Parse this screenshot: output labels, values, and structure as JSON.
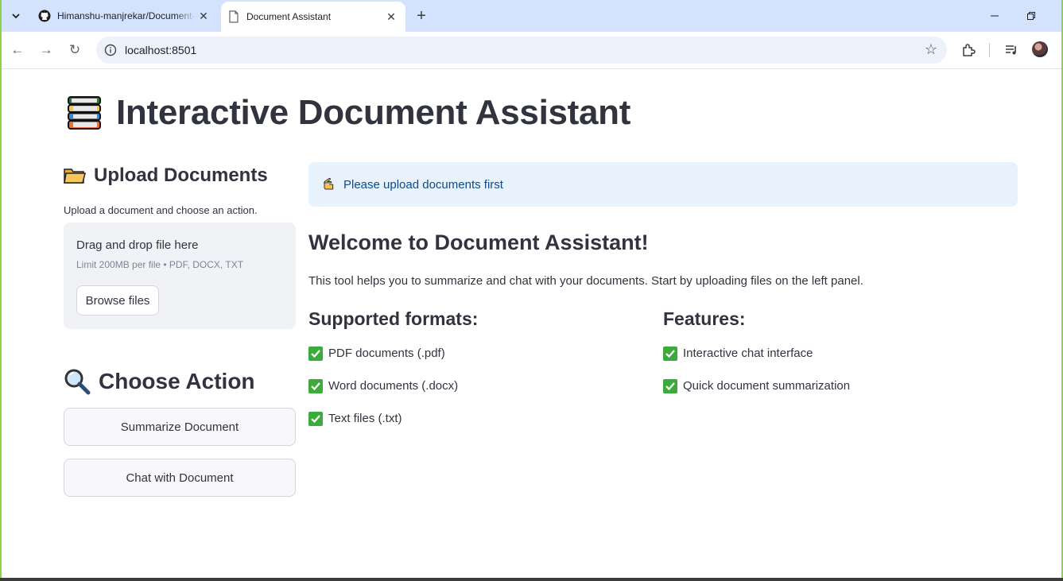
{
  "browser": {
    "tabs": [
      {
        "title": "Himanshu-manjrekar/Document-Assistant",
        "active": false,
        "icon": "github-icon"
      },
      {
        "title": "Document Assistant",
        "active": true,
        "icon": "document-icon"
      }
    ],
    "url": "localhost:8501"
  },
  "page": {
    "title": "Interactive Document Assistant",
    "title_icon": "books-emoji",
    "sidebar": {
      "upload_title": "Upload Documents",
      "upload_icon": "folder-emoji",
      "caption": "Upload a document and choose an action.",
      "dropzone": {
        "title": "Drag and drop file here",
        "limit": "Limit 200MB per file • PDF, DOCX, TXT",
        "browse_label": "Browse files"
      },
      "action_title": "Choose Action",
      "action_icon": "magnifier-emoji",
      "buttons": {
        "summarize": "Summarize Document",
        "chat": "Chat with Document"
      }
    },
    "main": {
      "alert": "Please upload documents first",
      "alert_icon": "pointing-hand-emoji",
      "welcome": "Welcome to Document Assistant!",
      "intro": "This tool helps you to summarize and chat with your documents. Start by uploading files on the left panel.",
      "formats": {
        "title": "Supported formats:",
        "items": [
          "PDF documents (.pdf)",
          "Word documents (.docx)",
          "Text files (.txt)"
        ]
      },
      "features": {
        "title": "Features:",
        "items": [
          "Interactive chat interface",
          "Quick document summarization"
        ]
      }
    }
  },
  "colors": {
    "tabbar": "#d3e3fd",
    "alert_bg": "#e8f2fd",
    "alert_text": "#0d4a86",
    "check": "#3cab3c",
    "text": "#31333f"
  }
}
